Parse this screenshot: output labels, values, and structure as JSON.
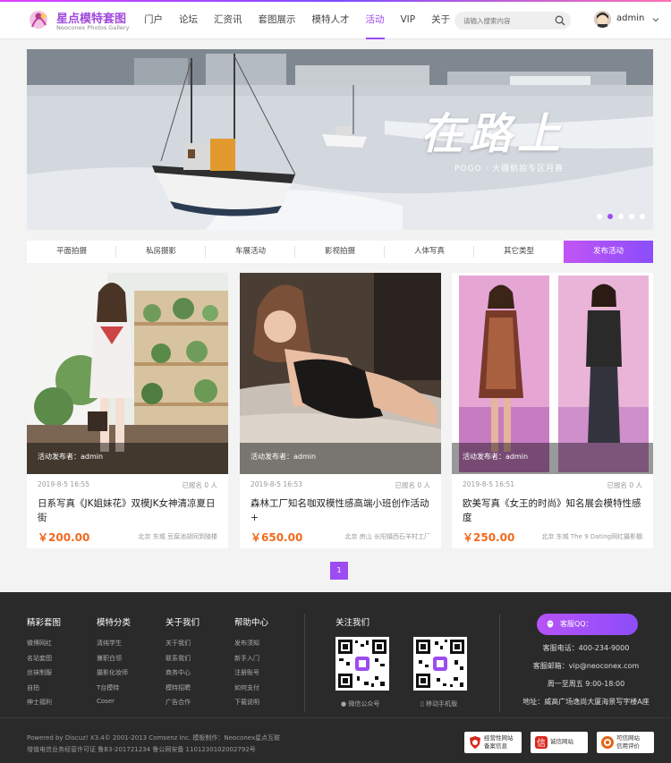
{
  "header": {
    "logo_title": "星点模特套图",
    "logo_subtitle": "Neoconex Photos Gallery",
    "nav": [
      "门户",
      "论坛",
      "汇资讯",
      "套图展示",
      "模特人才",
      "活动",
      "VIP",
      "关于"
    ],
    "active_nav": "活动",
    "search_placeholder": "请输入搜索内容",
    "username": "admin"
  },
  "banner": {
    "title": "在路上",
    "subtitle": "POGO · 大疆航拍专区月赛",
    "slides": 5,
    "active_slide": 2
  },
  "tabs": [
    "平面拍摄",
    "私房摄影",
    "车展活动",
    "影视拍摄",
    "人体写真",
    "其它类型"
  ],
  "publish_label": "发布活动",
  "cards": [
    {
      "publisher": "活动发布者：admin",
      "date": "2019-8-5 16:55",
      "signup": "已报名 0 人",
      "title": "日系写真《JK姐妹花》双模JK女神清凉夏日街",
      "price": "￥200.00",
      "location": "北京 东城 豆腐池胡同到陵楼"
    },
    {
      "publisher": "活动发布者：admin",
      "date": "2019-8-5 16:53",
      "signup": "已报名 0 人",
      "title": "森林工厂知名咖双模性感高端小班创作活动 +",
      "price": "￥650.00",
      "location": "北京 房山 长阳镇西石羊村工厂"
    },
    {
      "publisher": "活动发布者：admin",
      "date": "2019-8-5 16:51",
      "signup": "已报名 0 人",
      "title": "欧美写真《女王的时尚》知名展会模特性感度",
      "price": "￥250.00",
      "location": "北京 东城 The 9 Dating网红摄影棚"
    }
  ],
  "pagination": {
    "current": "1"
  },
  "footer": {
    "columns": [
      {
        "title": "精彩套图",
        "items": [
          "微博网红",
          "名站套图",
          "丝袜制服",
          "自拍",
          "绅士福利"
        ]
      },
      {
        "title": "模特分类",
        "items": [
          "清纯学生",
          "兼职白领",
          "摄影化妆师",
          "T台模特",
          "Coser"
        ]
      },
      {
        "title": "关于我们",
        "items": [
          "关于我们",
          "联系我们",
          "商务中心",
          "模特招聘",
          "广告合作"
        ]
      },
      {
        "title": "帮助中心",
        "items": [
          "发布须知",
          "新手入门",
          "注册账号",
          "如何支付",
          "下载说明"
        ]
      }
    ],
    "follow_title": "关注我们",
    "qr_captions": [
      "微信公众号",
      "移动手机版"
    ],
    "kefu_label": "客服QQ：",
    "contact": [
      "客服电话：400-234-9000",
      "客服邮箱：vip@neoconex.com",
      "周一至周五 9:00-18:00",
      "地址：威高广场逸尚大厦海景写字楼A座"
    ],
    "copyright_line1": "Powered by Discuz!  X3.4© 2001-2013 Comsenz Inc.  模板制作：Neoconex星点互联",
    "copyright_line2": "增值电信业务经营许可证 鲁B3-201721234   鲁公网安备 11012301020027​92号",
    "badges": [
      {
        "line1": "经营性网站",
        "line2": "备案信息",
        "color": "#d9261c"
      },
      {
        "line1": "诚信网站",
        "line2": "",
        "color": "#d9261c"
      },
      {
        "line1": "可信网站",
        "line2": "信用评价",
        "color": "#e2641a"
      }
    ]
  }
}
